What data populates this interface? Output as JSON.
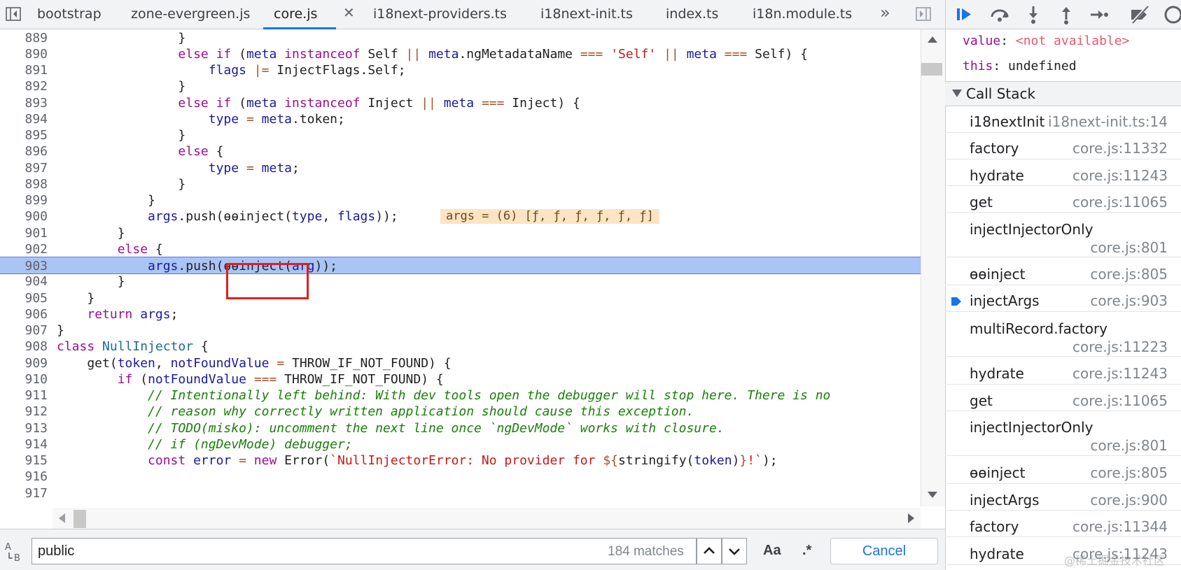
{
  "tabs": [
    {
      "label": "bootstrap"
    },
    {
      "label": "zone-evergreen.js"
    },
    {
      "label": "core.js",
      "active": true
    },
    {
      "label": "i18next-providers.ts"
    },
    {
      "label": "i18next-init.ts"
    },
    {
      "label": "index.ts"
    },
    {
      "label": "i18n.module.ts"
    }
  ],
  "tab_close_glyph": "✕",
  "more_tabs_glyph": "»",
  "editor": {
    "lines": [
      {
        "n": "889"
      },
      {
        "n": "890"
      },
      {
        "n": "891"
      },
      {
        "n": "892"
      },
      {
        "n": "893"
      },
      {
        "n": "894"
      },
      {
        "n": "895"
      },
      {
        "n": "896"
      },
      {
        "n": "897"
      },
      {
        "n": "898"
      },
      {
        "n": "899"
      },
      {
        "n": "900"
      },
      {
        "n": "901"
      },
      {
        "n": "902"
      },
      {
        "n": "903"
      },
      {
        "n": "904"
      },
      {
        "n": "905"
      },
      {
        "n": "906"
      },
      {
        "n": "907"
      },
      {
        "n": "908"
      },
      {
        "n": "909"
      },
      {
        "n": "910"
      },
      {
        "n": "911"
      },
      {
        "n": "912"
      },
      {
        "n": "913"
      },
      {
        "n": "914"
      },
      {
        "n": "915"
      },
      {
        "n": "916"
      },
      {
        "n": "917"
      }
    ],
    "inline_value": "args = (6) [ƒ, ƒ, ƒ, ƒ, ƒ, ƒ]",
    "execution_line": "903"
  },
  "search": {
    "value": "public",
    "match_count": "184 matches",
    "case_label": "Aa",
    "regex_label": ".*",
    "cancel_label": "Cancel"
  },
  "scope": {
    "value_key": "value",
    "value_val": "<not available>",
    "this_key": "this",
    "this_val": "undefined"
  },
  "call_stack": {
    "title": "Call Stack",
    "frames": [
      {
        "name": "i18nextInit",
        "loc": "i18next-init.ts:14"
      },
      {
        "name": "factory",
        "loc": "core.js:11332"
      },
      {
        "name": "hydrate",
        "loc": "core.js:11243"
      },
      {
        "name": "get",
        "loc": "core.js:11065"
      },
      {
        "name": "injectInjectorOnly",
        "loc": "core.js:801"
      },
      {
        "name": "ɵɵinject",
        "loc": "core.js:805"
      },
      {
        "name": "injectArgs",
        "loc": "core.js:903",
        "current": true
      },
      {
        "name": "multiRecord.factory",
        "loc": "core.js:11223"
      },
      {
        "name": "hydrate",
        "loc": "core.js:11243"
      },
      {
        "name": "get",
        "loc": "core.js:11065"
      },
      {
        "name": "injectInjectorOnly",
        "loc": "core.js:801"
      },
      {
        "name": "ɵɵinject",
        "loc": "core.js:805"
      },
      {
        "name": "injectArgs",
        "loc": "core.js:900"
      },
      {
        "name": "factory",
        "loc": "core.js:11344"
      },
      {
        "name": "hydrate",
        "loc": "core.js:11243"
      }
    ]
  },
  "watermark": "@稀土掘金技术社区",
  "colors": {
    "accent": "#1a73e8",
    "exec_highlight": "#aac4f5",
    "annotation_box": "#e0201f",
    "inline_value_bg": "#fce4c4"
  }
}
